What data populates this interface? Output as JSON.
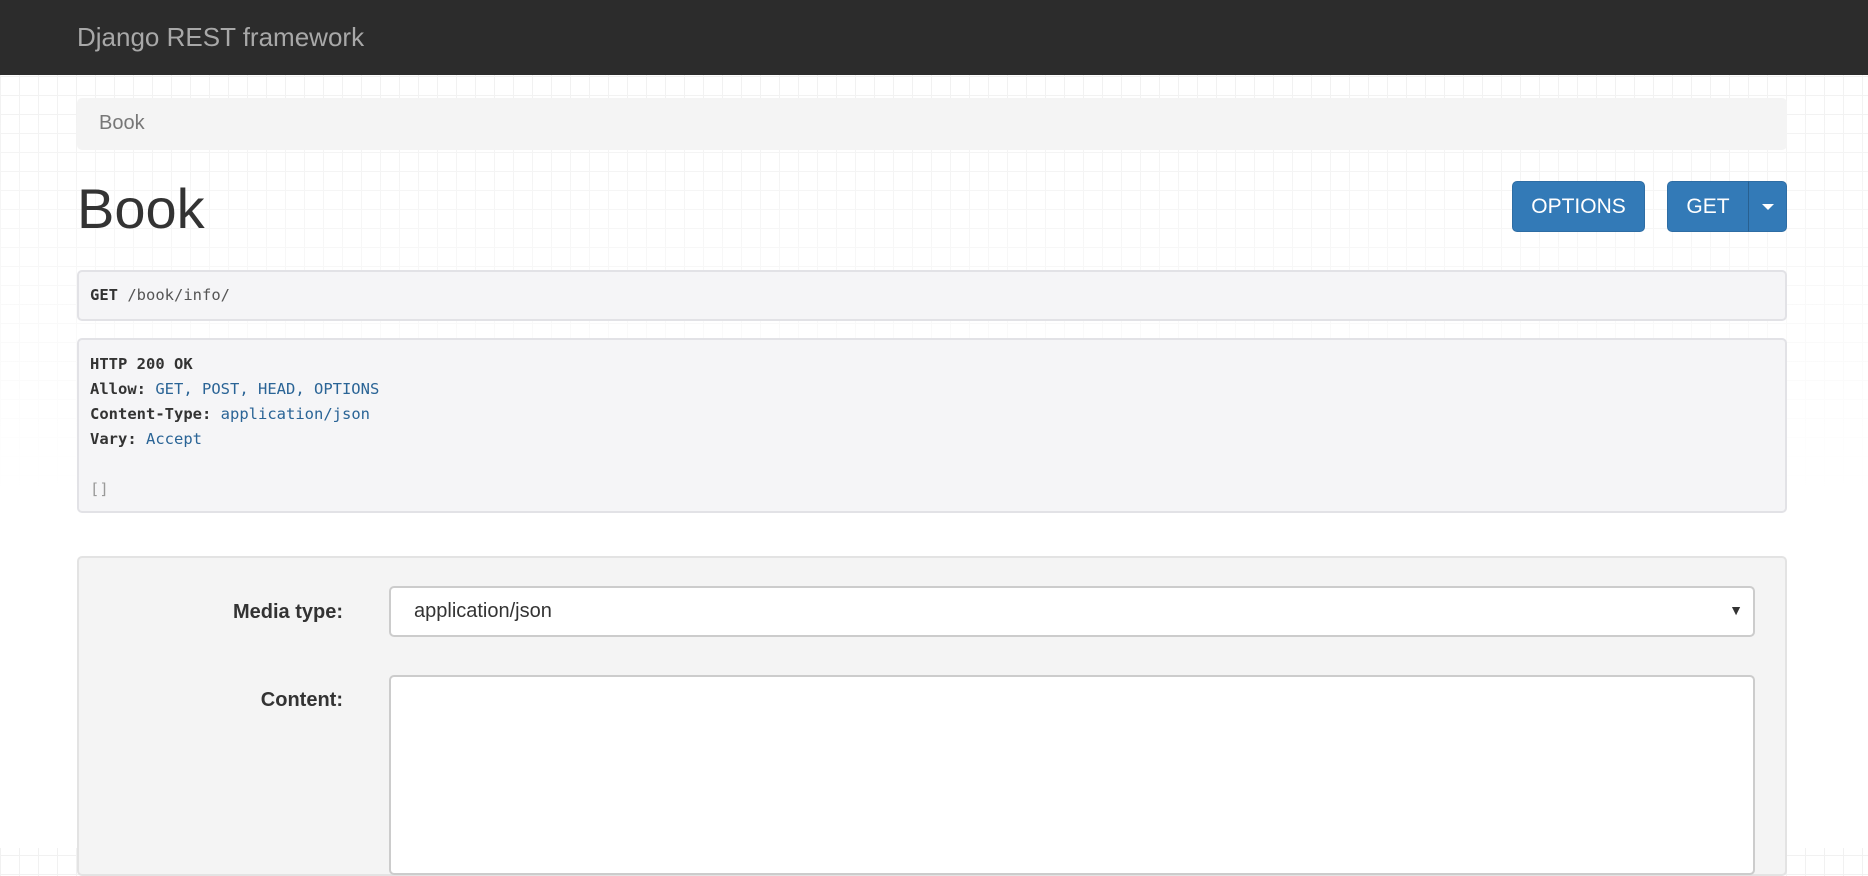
{
  "navbar": {
    "brand": "Django REST framework"
  },
  "breadcrumb": {
    "items": [
      "Book"
    ]
  },
  "page": {
    "title": "Book"
  },
  "toolbar": {
    "options_label": "OPTIONS",
    "get_label": "GET"
  },
  "request": {
    "method": "GET",
    "path": "/book/info/"
  },
  "response": {
    "status": "HTTP 200 OK",
    "headers": [
      {
        "name": "Allow:",
        "value": "GET, POST, HEAD, OPTIONS"
      },
      {
        "name": "Content-Type:",
        "value": "application/json"
      },
      {
        "name": "Vary:",
        "value": "Accept"
      }
    ],
    "body": "[]"
  },
  "form": {
    "media_type_label": "Media type:",
    "media_type_value": "application/json",
    "content_label": "Content:",
    "content_value": ""
  }
}
